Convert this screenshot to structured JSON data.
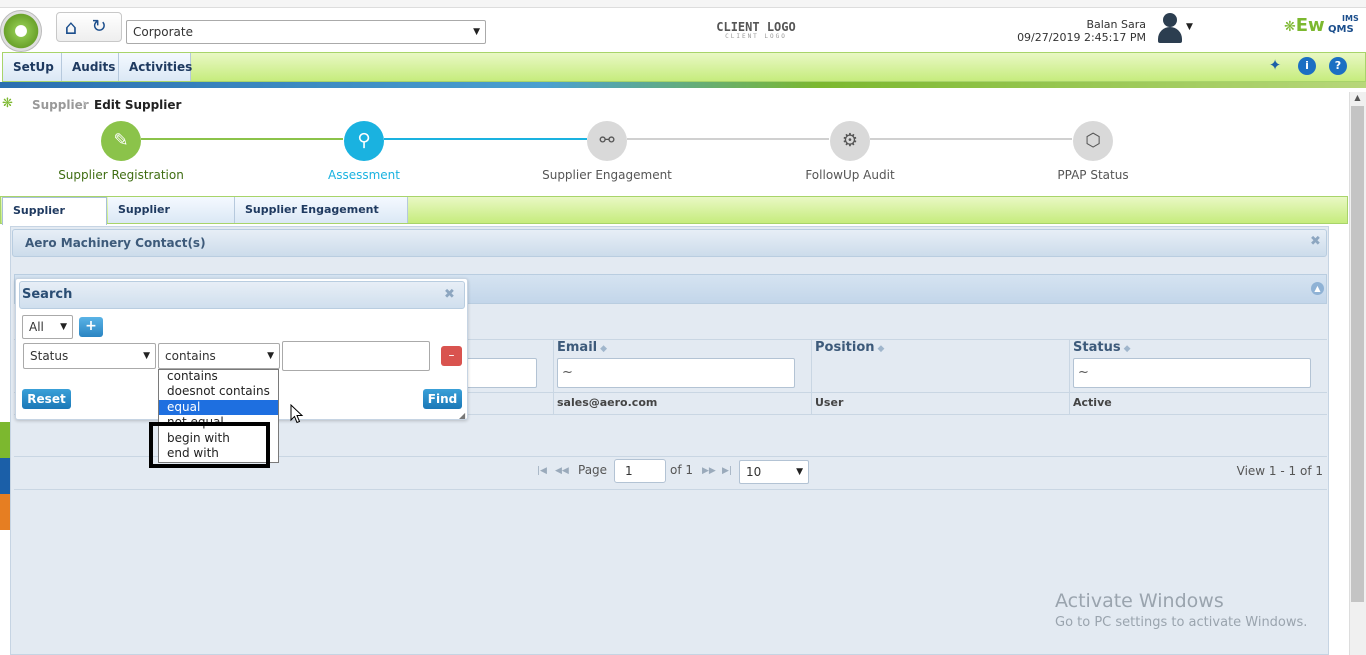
{
  "header": {
    "org_select": "Corporate",
    "client_logo": "CLIENT LOGO",
    "client_logo_sub": "CLIENT LOGO",
    "user_name": "Balan Sara",
    "datetime": "09/27/2019 2:45:17 PM",
    "brand": "Ew",
    "brand_ims": "IMS",
    "brand_qms": "QMS"
  },
  "nav": {
    "items": [
      {
        "label": "SetUp"
      },
      {
        "label": "Audits"
      },
      {
        "label": "Activities"
      }
    ]
  },
  "breadcrumb": {
    "parent": "Supplier",
    "current": "Edit Supplier"
  },
  "stepper": {
    "steps": [
      {
        "label": "Supplier Registration",
        "state": "done"
      },
      {
        "label": "Assessment",
        "state": "active"
      },
      {
        "label": "Supplier Engagement",
        "state": "pending"
      },
      {
        "label": "FollowUp Audit",
        "state": "pending"
      },
      {
        "label": "PPAP Status",
        "state": "pending"
      }
    ]
  },
  "tabs": [
    {
      "label": "Supplier Details",
      "active": true
    },
    {
      "label": "Supplier Evaluation",
      "active": false
    },
    {
      "label": "Supplier Engagement Model",
      "active": false
    }
  ],
  "panel": {
    "title": "Aero Machinery Contact(s)"
  },
  "grid": {
    "columns": [
      "Email",
      "Position",
      "Status"
    ],
    "filters": [
      "~",
      "~"
    ],
    "rows": [
      {
        "email": "sales@aero.com",
        "position": "User",
        "status": "Active"
      }
    ]
  },
  "pager": {
    "page_label": "Page",
    "page": "1",
    "of_label": "of 1",
    "page_size": "10",
    "view": "View 1 - 1 of 1"
  },
  "search": {
    "title": "Search",
    "group_op": "All",
    "add_label": "+",
    "field": "Status",
    "operator": "contains",
    "delete_label": "–",
    "reset_label": "Reset",
    "find_label": "Find",
    "operators": [
      "contains",
      "doesnot contains",
      "equal",
      "not equal",
      "begin with",
      "end with"
    ],
    "highlighted_operator": "equal"
  },
  "watermark": {
    "line1": "Activate Windows",
    "line2": "Go to PC settings to activate Windows."
  },
  "colors": {
    "accent_green": "#7cb82f",
    "accent_blue": "#1ab2e0",
    "step_pending": "#d9d9d9"
  }
}
